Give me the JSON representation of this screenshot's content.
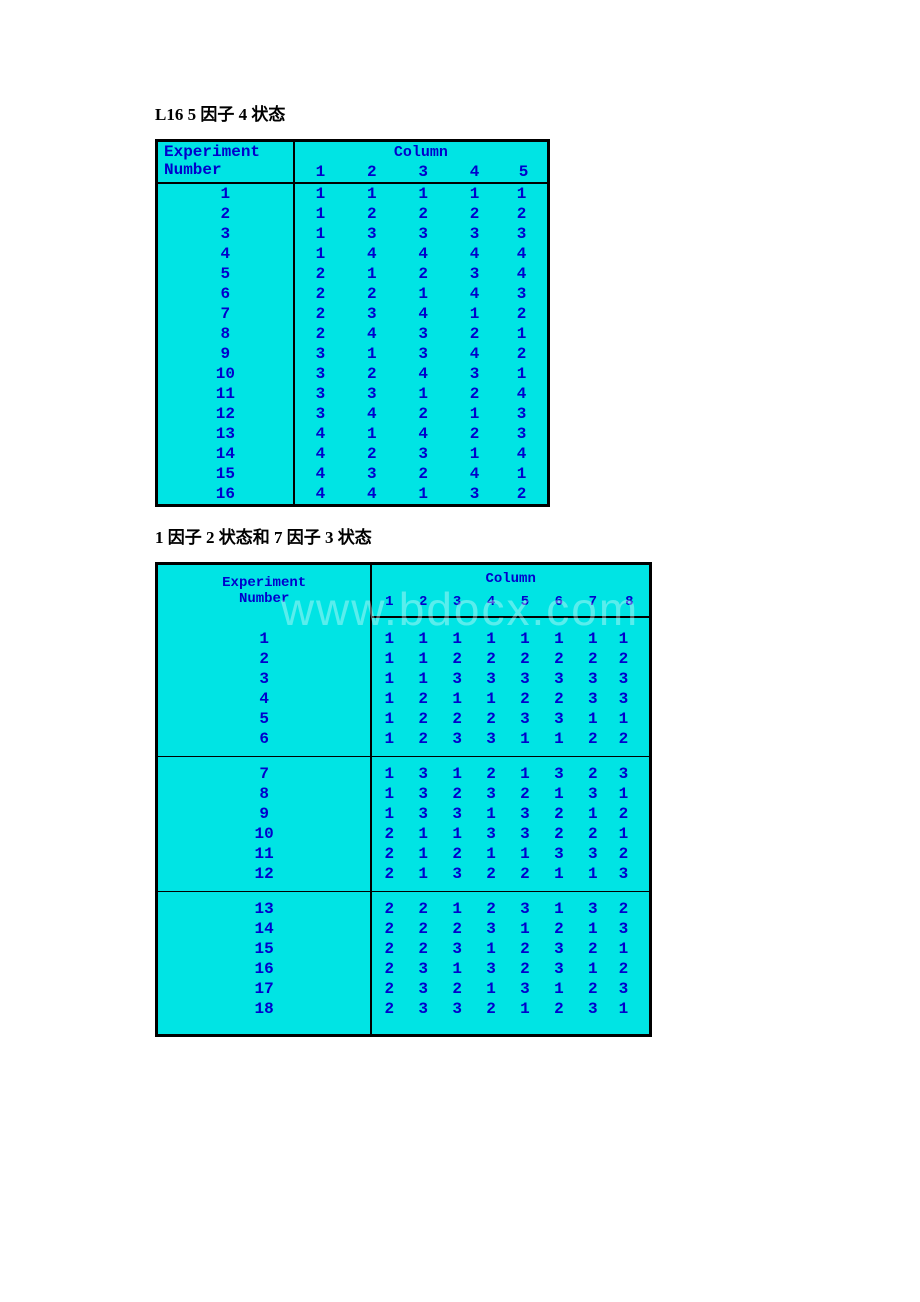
{
  "title1": "L16 5 因子 4 状态",
  "title2": "1 因子 2 状态和 7 因子 3 状态",
  "watermark": "www.bdocx.com",
  "chart_data": [
    {
      "type": "table",
      "title": "L16 5 因子 4 状态",
      "header_experiment": "Experiment Number",
      "header_column": "Column",
      "columns": [
        "1",
        "2",
        "3",
        "4",
        "5"
      ],
      "rows": [
        {
          "exp": "1",
          "v": [
            "1",
            "1",
            "1",
            "1",
            "1"
          ]
        },
        {
          "exp": "2",
          "v": [
            "1",
            "2",
            "2",
            "2",
            "2"
          ]
        },
        {
          "exp": "3",
          "v": [
            "1",
            "3",
            "3",
            "3",
            "3"
          ]
        },
        {
          "exp": "4",
          "v": [
            "1",
            "4",
            "4",
            "4",
            "4"
          ]
        },
        {
          "exp": "5",
          "v": [
            "2",
            "1",
            "2",
            "3",
            "4"
          ]
        },
        {
          "exp": "6",
          "v": [
            "2",
            "2",
            "1",
            "4",
            "3"
          ]
        },
        {
          "exp": "7",
          "v": [
            "2",
            "3",
            "4",
            "1",
            "2"
          ]
        },
        {
          "exp": "8",
          "v": [
            "2",
            "4",
            "3",
            "2",
            "1"
          ]
        },
        {
          "exp": "9",
          "v": [
            "3",
            "1",
            "3",
            "4",
            "2"
          ]
        },
        {
          "exp": "10",
          "v": [
            "3",
            "2",
            "4",
            "3",
            "1"
          ]
        },
        {
          "exp": "11",
          "v": [
            "3",
            "3",
            "1",
            "2",
            "4"
          ]
        },
        {
          "exp": "12",
          "v": [
            "3",
            "4",
            "2",
            "1",
            "3"
          ]
        },
        {
          "exp": "13",
          "v": [
            "4",
            "1",
            "4",
            "2",
            "3"
          ]
        },
        {
          "exp": "14",
          "v": [
            "4",
            "2",
            "3",
            "1",
            "4"
          ]
        },
        {
          "exp": "15",
          "v": [
            "4",
            "3",
            "2",
            "4",
            "1"
          ]
        },
        {
          "exp": "16",
          "v": [
            "4",
            "4",
            "1",
            "3",
            "2"
          ]
        }
      ]
    },
    {
      "type": "table",
      "title": "1 因子 2 状态和 7 因子 3 状态",
      "header_experiment": "Experiment Number",
      "header_column": "Column",
      "columns": [
        "1",
        "2",
        "3",
        "4",
        "5",
        "6",
        "7",
        "8"
      ],
      "rows": [
        {
          "exp": "1",
          "v": [
            "1",
            "1",
            "1",
            "1",
            "1",
            "1",
            "1",
            "1"
          ]
        },
        {
          "exp": "2",
          "v": [
            "1",
            "1",
            "2",
            "2",
            "2",
            "2",
            "2",
            "2"
          ]
        },
        {
          "exp": "3",
          "v": [
            "1",
            "1",
            "3",
            "3",
            "3",
            "3",
            "3",
            "3"
          ]
        },
        {
          "exp": "4",
          "v": [
            "1",
            "2",
            "1",
            "1",
            "2",
            "2",
            "3",
            "3"
          ]
        },
        {
          "exp": "5",
          "v": [
            "1",
            "2",
            "2",
            "2",
            "3",
            "3",
            "1",
            "1"
          ]
        },
        {
          "exp": "6",
          "v": [
            "1",
            "2",
            "3",
            "3",
            "1",
            "1",
            "2",
            "2"
          ]
        },
        {
          "exp": "7",
          "v": [
            "1",
            "3",
            "1",
            "2",
            "1",
            "3",
            "2",
            "3"
          ]
        },
        {
          "exp": "8",
          "v": [
            "1",
            "3",
            "2",
            "3",
            "2",
            "1",
            "3",
            "1"
          ]
        },
        {
          "exp": "9",
          "v": [
            "1",
            "3",
            "3",
            "1",
            "3",
            "2",
            "1",
            "2"
          ]
        },
        {
          "exp": "10",
          "v": [
            "2",
            "1",
            "1",
            "3",
            "3",
            "2",
            "2",
            "1"
          ]
        },
        {
          "exp": "11",
          "v": [
            "2",
            "1",
            "2",
            "1",
            "1",
            "3",
            "3",
            "2"
          ]
        },
        {
          "exp": "12",
          "v": [
            "2",
            "1",
            "3",
            "2",
            "2",
            "1",
            "1",
            "3"
          ]
        },
        {
          "exp": "13",
          "v": [
            "2",
            "2",
            "1",
            "2",
            "3",
            "1",
            "3",
            "2"
          ]
        },
        {
          "exp": "14",
          "v": [
            "2",
            "2",
            "2",
            "3",
            "1",
            "2",
            "1",
            "3"
          ]
        },
        {
          "exp": "15",
          "v": [
            "2",
            "2",
            "3",
            "1",
            "2",
            "3",
            "2",
            "1"
          ]
        },
        {
          "exp": "16",
          "v": [
            "2",
            "3",
            "1",
            "3",
            "2",
            "3",
            "1",
            "2"
          ]
        },
        {
          "exp": "17",
          "v": [
            "2",
            "3",
            "2",
            "1",
            "3",
            "1",
            "2",
            "3"
          ]
        },
        {
          "exp": "18",
          "v": [
            "2",
            "3",
            "3",
            "2",
            "1",
            "2",
            "3",
            "1"
          ]
        }
      ]
    }
  ]
}
